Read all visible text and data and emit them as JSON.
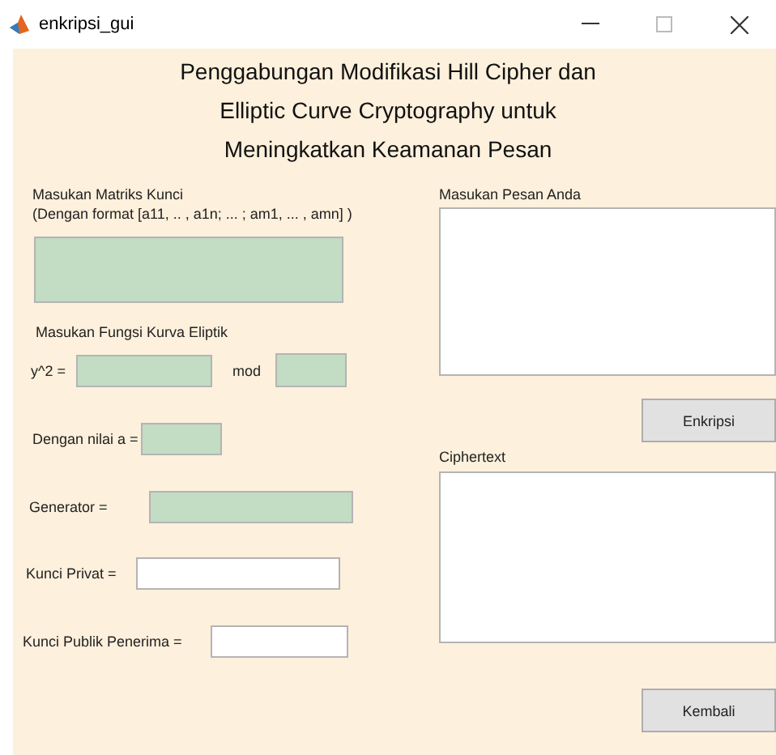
{
  "window": {
    "title": "enkripsi_gui"
  },
  "heading": [
    "Penggabungan Modifikasi Hill Cipher dan",
    "Elliptic Curve Cryptography untuk",
    "Meningkatkan Keamanan Pesan"
  ],
  "key_matrix": {
    "label": "Masukan Matriks Kunci",
    "hint": "(Dengan format [a11, .. , a1n; ... ; am1, ... , amn] )",
    "kind": "tinted"
  },
  "curve": {
    "label": "Masukan Fungsi Kurva Eliptik",
    "equation_label": "y^2 =",
    "mod_label": "mod",
    "kind": "tinted"
  },
  "fields": [
    {
      "label": "Dengan nilai a =",
      "kind": "tinted"
    },
    {
      "label": "Generator =",
      "kind": "tinted"
    },
    {
      "label": "Kunci Privat =",
      "kind": "plain"
    },
    {
      "label": "Kunci Publik Penerima =",
      "kind": "plain"
    }
  ],
  "message": {
    "label": "Masukan Pesan Anda"
  },
  "encrypt_button": "Enkripsi",
  "ciphertext": {
    "label": "Ciphertext"
  },
  "back_button": "Kembali"
}
